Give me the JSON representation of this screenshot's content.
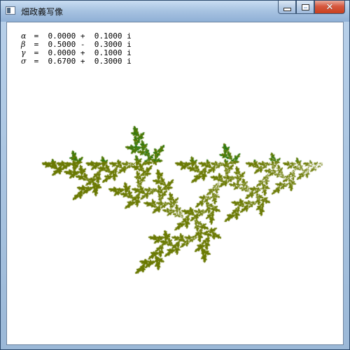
{
  "window": {
    "title": "畑政義写像",
    "icon": "app-window-icon",
    "buttons": {
      "minimize": "minimize-icon",
      "maximize": "maximize-icon",
      "close": "close-icon"
    }
  },
  "params": [
    {
      "symbol": "α",
      "text": " =  0.0000 +  0.1000 i"
    },
    {
      "symbol": "β",
      "text": " =  0.5000 -  0.3000 i"
    },
    {
      "symbol": "γ",
      "text": " =  0.0000 +  0.1000 i"
    },
    {
      "symbol": "σ",
      "text": " =  0.6700 +  0.3000 i"
    }
  ],
  "fractal": {
    "alpha": [
      0.0,
      0.1
    ],
    "beta": [
      0.5,
      -0.3
    ],
    "gamma": [
      0.0,
      0.1
    ],
    "sigma": [
      0.67,
      0.3
    ],
    "colors": {
      "primary": "#6b7a00",
      "secondary": "#007a1e"
    }
  }
}
